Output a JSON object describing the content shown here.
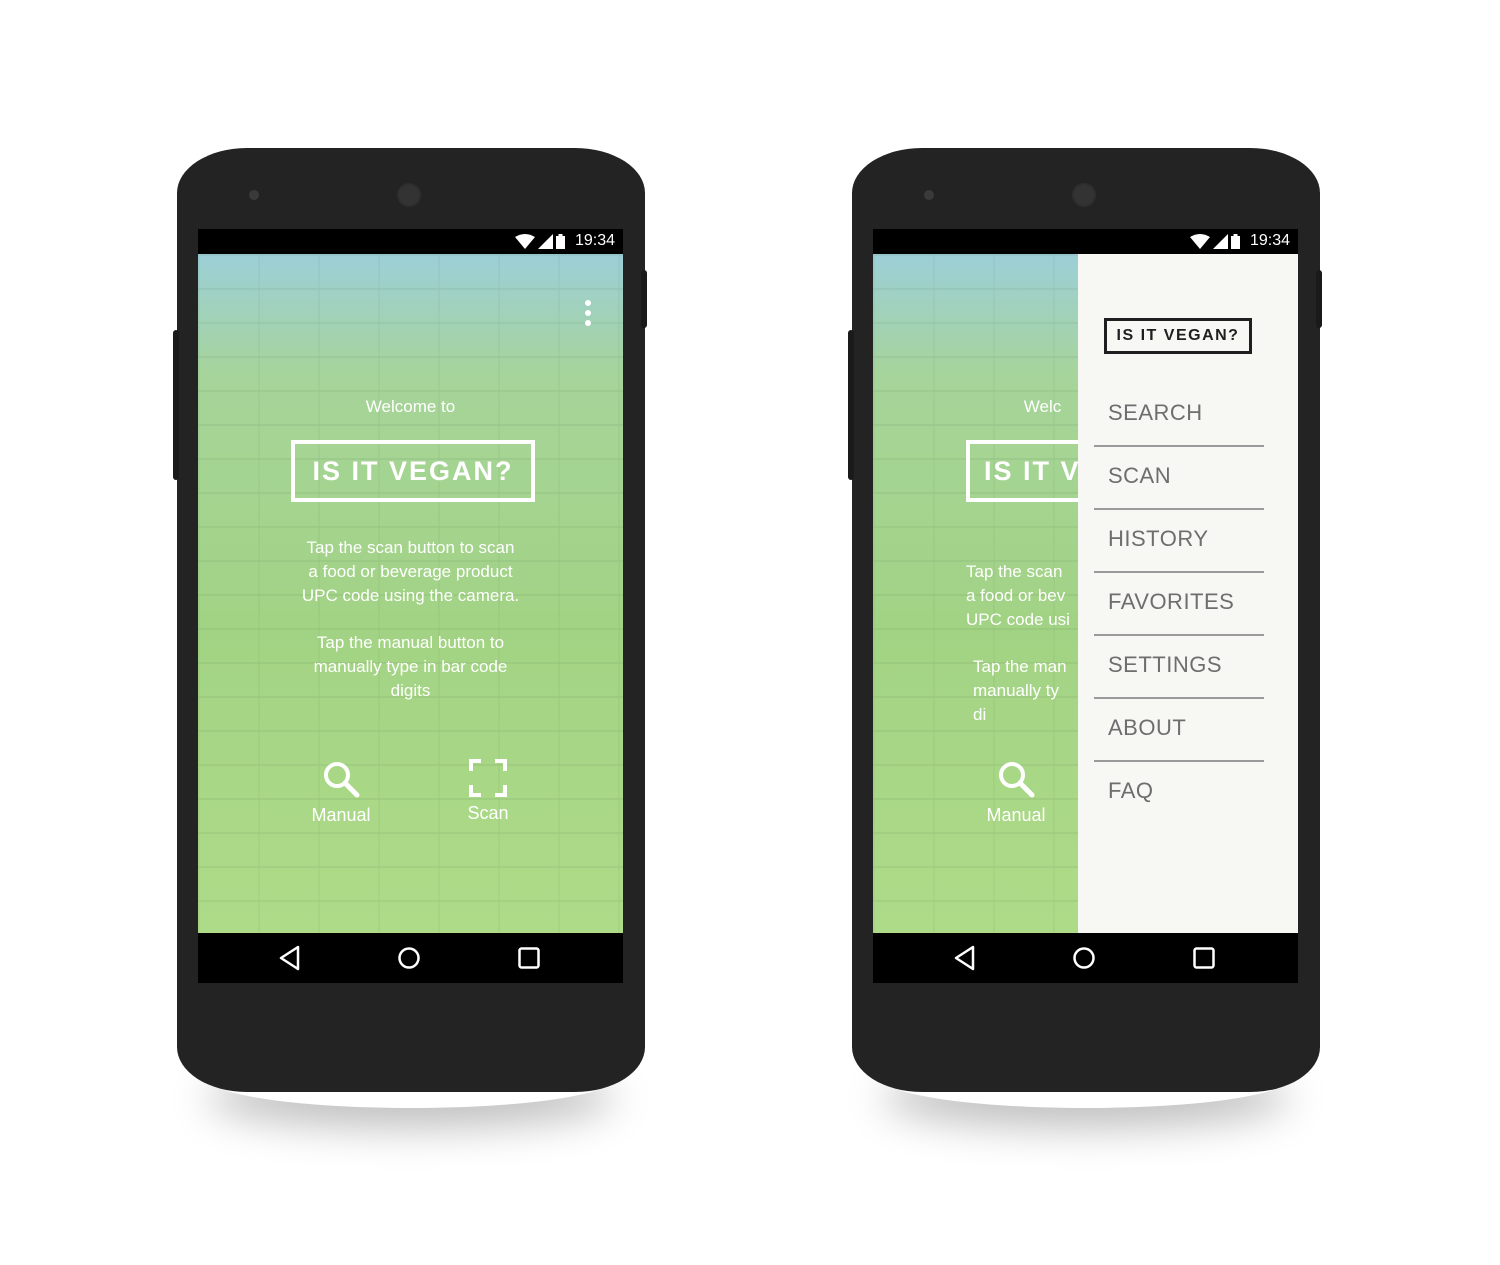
{
  "status_bar": {
    "time": "19:34"
  },
  "home": {
    "welcome": "Welcome to",
    "logo": "IS IT VEGAN?",
    "description_scan": "Tap the scan button to scan\na food or beverage product\nUPC code using the camera.",
    "description_manual": "Tap the manual button to\nmanually type in bar code\ndigits",
    "manual_label": "Manual",
    "scan_label": "Scan"
  },
  "drawer_screen": {
    "welcome_partial": "Welc",
    "logo_partial": "IS IT V",
    "description_scan_partial": "Tap the scan\na food or bev\nUPC code usi",
    "description_manual_partial": "Tap the man\nmanually ty\ndi",
    "manual_label": "Manual"
  },
  "drawer": {
    "logo": "IS IT VEGAN?",
    "items": [
      {
        "label": "SEARCH"
      },
      {
        "label": "SCAN"
      },
      {
        "label": "HISTORY"
      },
      {
        "label": "FAVORITES"
      },
      {
        "label": "SETTINGS"
      },
      {
        "label": "ABOUT"
      },
      {
        "label": "FAQ"
      }
    ]
  },
  "icons": {
    "menu": "overflow-menu-icon",
    "manual": "search-icon",
    "scan": "scan-frame-icon",
    "back": "back-triangle-icon",
    "home": "home-circle-icon",
    "recents": "recents-square-icon",
    "wifi": "wifi-icon",
    "signal": "signal-icon",
    "battery": "battery-icon"
  },
  "colors": {
    "phone_body": "#232323",
    "app_gradient_top": "#9ccfd8",
    "app_gradient_bottom": "#aedb88",
    "drawer_bg": "#f7f7f4",
    "drawer_text": "#6e6e6e"
  }
}
